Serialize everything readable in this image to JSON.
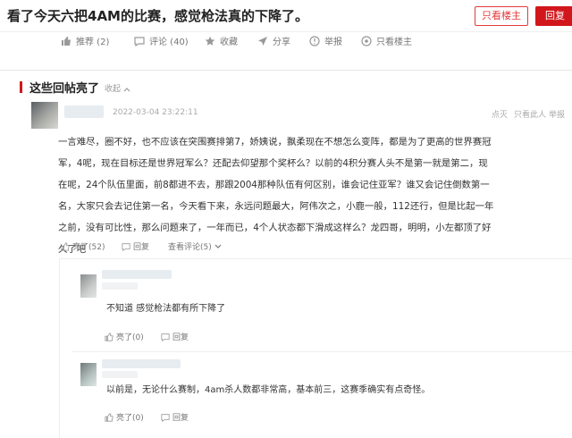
{
  "header": {
    "title": "看了今天六把4AM的比赛，感觉枪法真的下降了。",
    "only_op_label": "只看楼主",
    "reply_label": "回复"
  },
  "actions": [
    {
      "label": "推荐 (2)",
      "icon": "thumbs-up-icon"
    },
    {
      "label": "评论 (40)",
      "icon": "comment-icon"
    },
    {
      "label": "收藏",
      "icon": "star-icon"
    },
    {
      "label": "分享",
      "icon": "share-icon"
    },
    {
      "label": "举报",
      "icon": "report-icon"
    },
    {
      "label": "只看楼主",
      "icon": "eye-icon"
    }
  ],
  "section": {
    "title": "这些回帖亮了",
    "collapse_label": "收起"
  },
  "reply": {
    "timestamp": "2022-03-04 23:22:11",
    "meta_actions": [
      "点灭",
      "只看此人",
      "举报"
    ],
    "text": "一言难尽，圈不好，也不应该在突围赛排第7，娇姨说，飘柔现在不想怎么变阵，都是为了更高的世界赛冠军，4呢，现在目标还是世界冠军么？还配去仰望那个奖杯么？以前的4积分赛人头不是第一就是第二，现在呢，24个队伍里面，前8都进不去，那跟2004那种队伍有何区别，谁会记住亚军？谁又会记住倒数第一名，大家只会去记住第一名，今天看下来，永远问题最大，阿伟次之，小鹿一般，112还行，但是比起一年之前，没有可比性，那么问题来了，一年而已，4个人状态都下滑成这样么？龙四哥，明明，小左都顶了好久了吧",
    "like_label": "亮了(52)",
    "reply_label": "回复",
    "view_comments_label": "查看评论(5)"
  },
  "comments": [
    {
      "text": "不知道 感觉枪法都有所下降了",
      "like_label": "亮了(0)",
      "reply_label": "回复"
    },
    {
      "text": "以前是，无论什么赛制，4am杀人数都非常高，基本前三，这赛季确实有点奇怪。",
      "like_label": "亮了(0)",
      "reply_label": "回复"
    }
  ],
  "colors": {
    "accent": "#d2171c",
    "muted": "#999999"
  }
}
